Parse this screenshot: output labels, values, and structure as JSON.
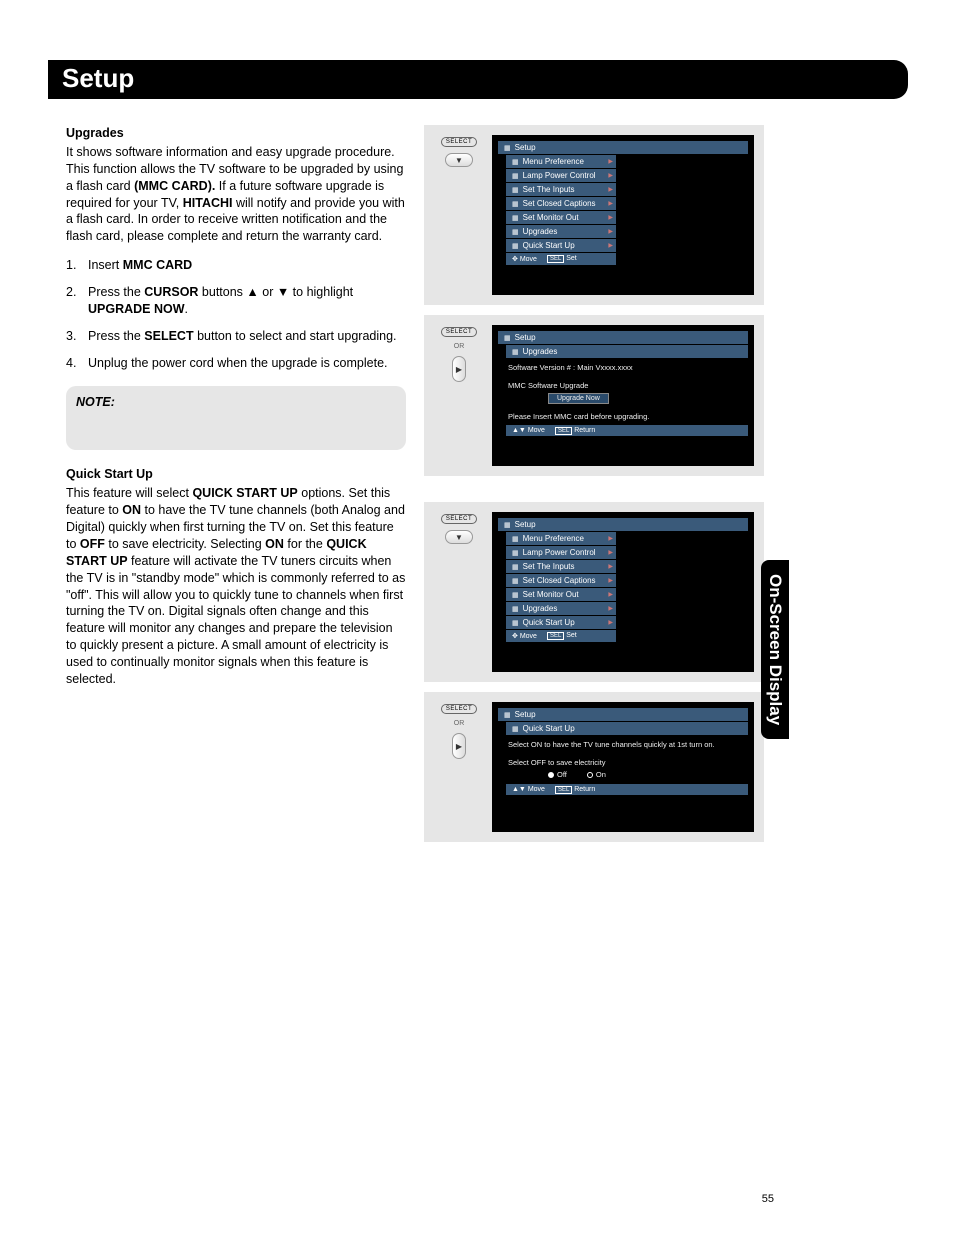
{
  "page": {
    "title": "Setup",
    "side_tab": "On-Screen Display",
    "page_number": "55"
  },
  "upgrades": {
    "heading": "Upgrades",
    "intro_1": "It shows software information and easy upgrade procedure. This function allows the TV software to be upgraded by using a flash card ",
    "mmc_card_bold": "(MMC CARD).",
    "intro_2": " If a future software upgrade is required for your TV, ",
    "hitachi_bold": "HITACHI",
    "intro_3": " will notify and provide you with a flash card. In order to receive written notification and the flash card, please complete and return the warranty card.",
    "steps": [
      {
        "num": "1.",
        "pre": "Insert ",
        "bold": "MMC CARD",
        "post": ""
      },
      {
        "num": "2.",
        "pre": "Press the ",
        "bold": "CURSOR",
        "post_pre": " buttons ▲ or ▼ to highlight ",
        "bold2": "UPGRADE NOW",
        "post": "."
      },
      {
        "num": "3.",
        "pre": "Press the ",
        "bold": "SELECT",
        "post": " button to select and start upgrading."
      },
      {
        "num": "4.",
        "pre": "Unplug the power cord when the upgrade is complete.",
        "bold": "",
        "post": ""
      }
    ],
    "note_label": "NOTE:"
  },
  "quick_start": {
    "heading": "Quick Start Up",
    "p1": "This feature will select ",
    "b1": "QUICK START UP",
    "p2": " options. Set this feature to ",
    "b2": "ON",
    "p3": " to have the TV tune channels (both Analog and Digital) quickly when first turning the TV on. Set this feature to ",
    "b3": "OFF",
    "p4": " to save electricity. Selecting ",
    "b4": "ON",
    "p5": " for the ",
    "b5": "QUICK START UP",
    "p6": " feature will activate the TV tuners circuits when the TV is in \"standby mode\" which is commonly referred to as \"off\". This will allow you to quickly tune to channels when first turning the TV on. Digital signals often change and this feature will monitor any changes and prepare the television to quickly present a picture. A small amount of electricity is used to continually monitor signals when this feature is selected."
  },
  "remote": {
    "select": "SELECT",
    "or": "OR"
  },
  "osd_menu": {
    "title": "Setup",
    "items": [
      "Menu Preference",
      "Lamp Power Control",
      "Set The Inputs",
      "Set Closed Captions",
      "Set Monitor Out",
      "Upgrades",
      "Quick Start Up"
    ],
    "footer_move": "Move",
    "footer_set": "Set",
    "footer_return": "Return",
    "sel": "SEL"
  },
  "osd_upgrades": {
    "sub": "Upgrades",
    "version": "Software Version #  :  Main Vxxxx.xxxx",
    "mmc": "MMC Software Upgrade",
    "upgrade_now": "Upgrade Now",
    "insert": "Please Insert MMC card before upgrading."
  },
  "osd_quick": {
    "sub": "Quick Start Up",
    "line1": "Select ON to have the TV tune channels quickly at 1st turn on.",
    "line2": "Select OFF to save electricity",
    "off": "Off",
    "on": "On"
  }
}
